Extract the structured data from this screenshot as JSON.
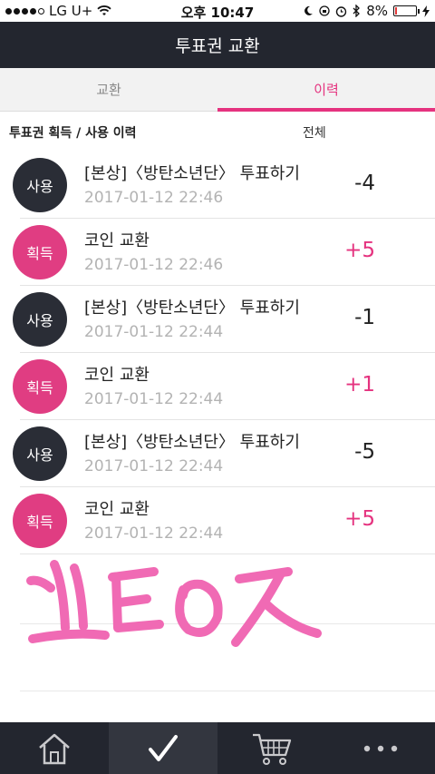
{
  "status_bar": {
    "carrier": "LG U+",
    "time": "오후 10:47",
    "battery": "8%",
    "battery_level": 0.08
  },
  "header": {
    "title": "투표권 교환"
  },
  "tabs": [
    {
      "label": "교환",
      "active": false
    },
    {
      "label": "이력",
      "active": true
    }
  ],
  "list": {
    "title": "투표권 획득 / 사용 이력",
    "filter_label": "전체",
    "rows": [
      {
        "badge": "사용",
        "type": "use",
        "title": "[본상]〈방탄소년단〉 투표하기",
        "date": "2017-01-12 22:46",
        "amount": "-4"
      },
      {
        "badge": "획득",
        "type": "get",
        "title": "코인 교환",
        "date": "2017-01-12 22:46",
        "amount": "+5"
      },
      {
        "badge": "사용",
        "type": "use",
        "title": "[본상]〈방탄소년단〉 투표하기",
        "date": "2017-01-12 22:44",
        "amount": "-1"
      },
      {
        "badge": "획득",
        "type": "get",
        "title": "코인 교환",
        "date": "2017-01-12 22:44",
        "amount": "+1"
      },
      {
        "badge": "사용",
        "type": "use",
        "title": "[본상]〈방탄소년단〉 투표하기",
        "date": "2017-01-12 22:44",
        "amount": "-5"
      },
      {
        "badge": "획득",
        "type": "get",
        "title": "코인 교환",
        "date": "2017-01-12 22:44",
        "amount": "+5"
      }
    ]
  },
  "tabbar": [
    {
      "icon": "home-icon",
      "active": false
    },
    {
      "icon": "check-icon",
      "active": true
    },
    {
      "icon": "cart-icon",
      "active": false
    },
    {
      "icon": "more-icon",
      "active": false
    }
  ],
  "colors": {
    "accent": "#e5337f",
    "header_bg": "#23262f",
    "use_badge": "#2a2d36",
    "get_badge": "#e03d82",
    "scribble": "#f06ab4"
  }
}
